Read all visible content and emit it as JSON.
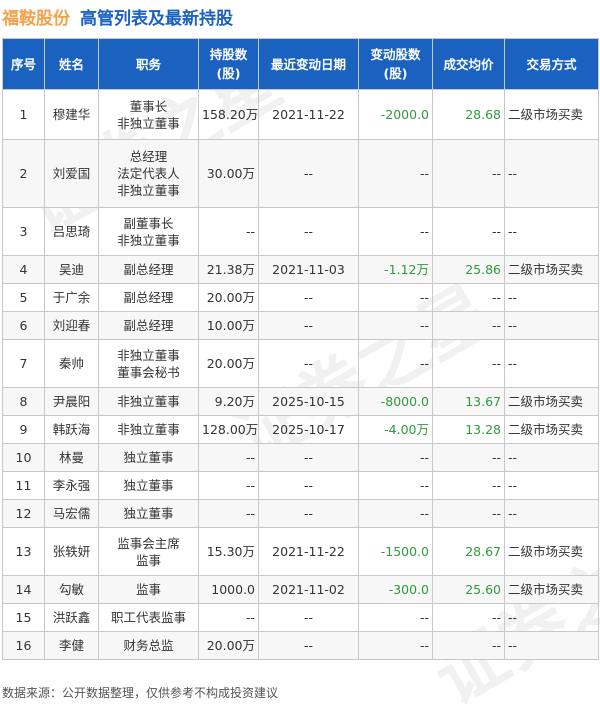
{
  "header": {
    "stock_name": "福鞍股份",
    "subtitle": "高管列表及最新持股"
  },
  "table": {
    "columns": [
      "序号",
      "姓名",
      "职务",
      "持股数\n(股)",
      "最近变动日期",
      "变动股数\n(股)",
      "成交均价",
      "交易方式"
    ],
    "rows": [
      {
        "idx": "1",
        "name": "穆建华",
        "position": [
          "董事长",
          "非独立董事"
        ],
        "shares": "158.20万",
        "date": "2021-11-22",
        "change": "-2000.0",
        "price": "28.68",
        "method": "二级市场买卖"
      },
      {
        "idx": "2",
        "name": "刘爱国",
        "position": [
          "总经理",
          "法定代表人",
          "非独立董事"
        ],
        "shares": "30.00万",
        "date": "--",
        "change": "--",
        "price": "--",
        "method": "--"
      },
      {
        "idx": "3",
        "name": "吕思琦",
        "position": [
          "副董事长",
          "非独立董事"
        ],
        "shares": "--",
        "date": "--",
        "change": "--",
        "price": "--",
        "method": "--"
      },
      {
        "idx": "4",
        "name": "吴迪",
        "position": [
          "副总经理"
        ],
        "shares": "21.38万",
        "date": "2021-11-03",
        "change": "-1.12万",
        "price": "25.86",
        "method": "二级市场买卖"
      },
      {
        "idx": "5",
        "name": "于广余",
        "position": [
          "副总经理"
        ],
        "shares": "20.00万",
        "date": "--",
        "change": "--",
        "price": "--",
        "method": "--"
      },
      {
        "idx": "6",
        "name": "刘迎春",
        "position": [
          "副总经理"
        ],
        "shares": "10.00万",
        "date": "--",
        "change": "--",
        "price": "--",
        "method": "--"
      },
      {
        "idx": "7",
        "name": "秦帅",
        "position": [
          "非独立董事",
          "董事会秘书"
        ],
        "shares": "20.00万",
        "date": "--",
        "change": "--",
        "price": "--",
        "method": "--"
      },
      {
        "idx": "8",
        "name": "尹晨阳",
        "position": [
          "非独立董事"
        ],
        "shares": "9.20万",
        "date": "2025-10-15",
        "change": "-8000.0",
        "price": "13.67",
        "method": "二级市场买卖"
      },
      {
        "idx": "9",
        "name": "韩跃海",
        "position": [
          "非独立董事"
        ],
        "shares": "128.00万",
        "date": "2025-10-17",
        "change": "-4.00万",
        "price": "13.28",
        "method": "二级市场买卖"
      },
      {
        "idx": "10",
        "name": "林曼",
        "position": [
          "独立董事"
        ],
        "shares": "--",
        "date": "--",
        "change": "--",
        "price": "--",
        "method": "--"
      },
      {
        "idx": "11",
        "name": "李永强",
        "position": [
          "独立董事"
        ],
        "shares": "--",
        "date": "--",
        "change": "--",
        "price": "--",
        "method": "--"
      },
      {
        "idx": "12",
        "name": "马宏儒",
        "position": [
          "独立董事"
        ],
        "shares": "--",
        "date": "--",
        "change": "--",
        "price": "--",
        "method": "--"
      },
      {
        "idx": "13",
        "name": "张轶妍",
        "position": [
          "监事会主席",
          "监事"
        ],
        "shares": "15.30万",
        "date": "2021-11-22",
        "change": "-1500.0",
        "price": "28.67",
        "method": "二级市场买卖"
      },
      {
        "idx": "14",
        "name": "勾敏",
        "position": [
          "监事"
        ],
        "shares": "1000.0",
        "date": "2021-11-02",
        "change": "-300.0",
        "price": "25.60",
        "method": "二级市场买卖"
      },
      {
        "idx": "15",
        "name": "洪跃鑫",
        "position": [
          "职工代表监事"
        ],
        "shares": "--",
        "date": "--",
        "change": "--",
        "price": "--",
        "method": "--"
      },
      {
        "idx": "16",
        "name": "李健",
        "position": [
          "财务总监"
        ],
        "shares": "20.00万",
        "date": "--",
        "change": "--",
        "price": "--",
        "method": "--"
      }
    ]
  },
  "footer": {
    "source": "数据来源：公开数据整理，仅供参考不构成投资建议"
  },
  "watermark": {
    "text": "证券之星"
  },
  "colors": {
    "header_bg": "#1b62c0",
    "stock_name": "#f4a24a",
    "subtitle": "#1b62c0",
    "change_value": "#2e9b3a",
    "price_value": "#2e9b3a"
  }
}
